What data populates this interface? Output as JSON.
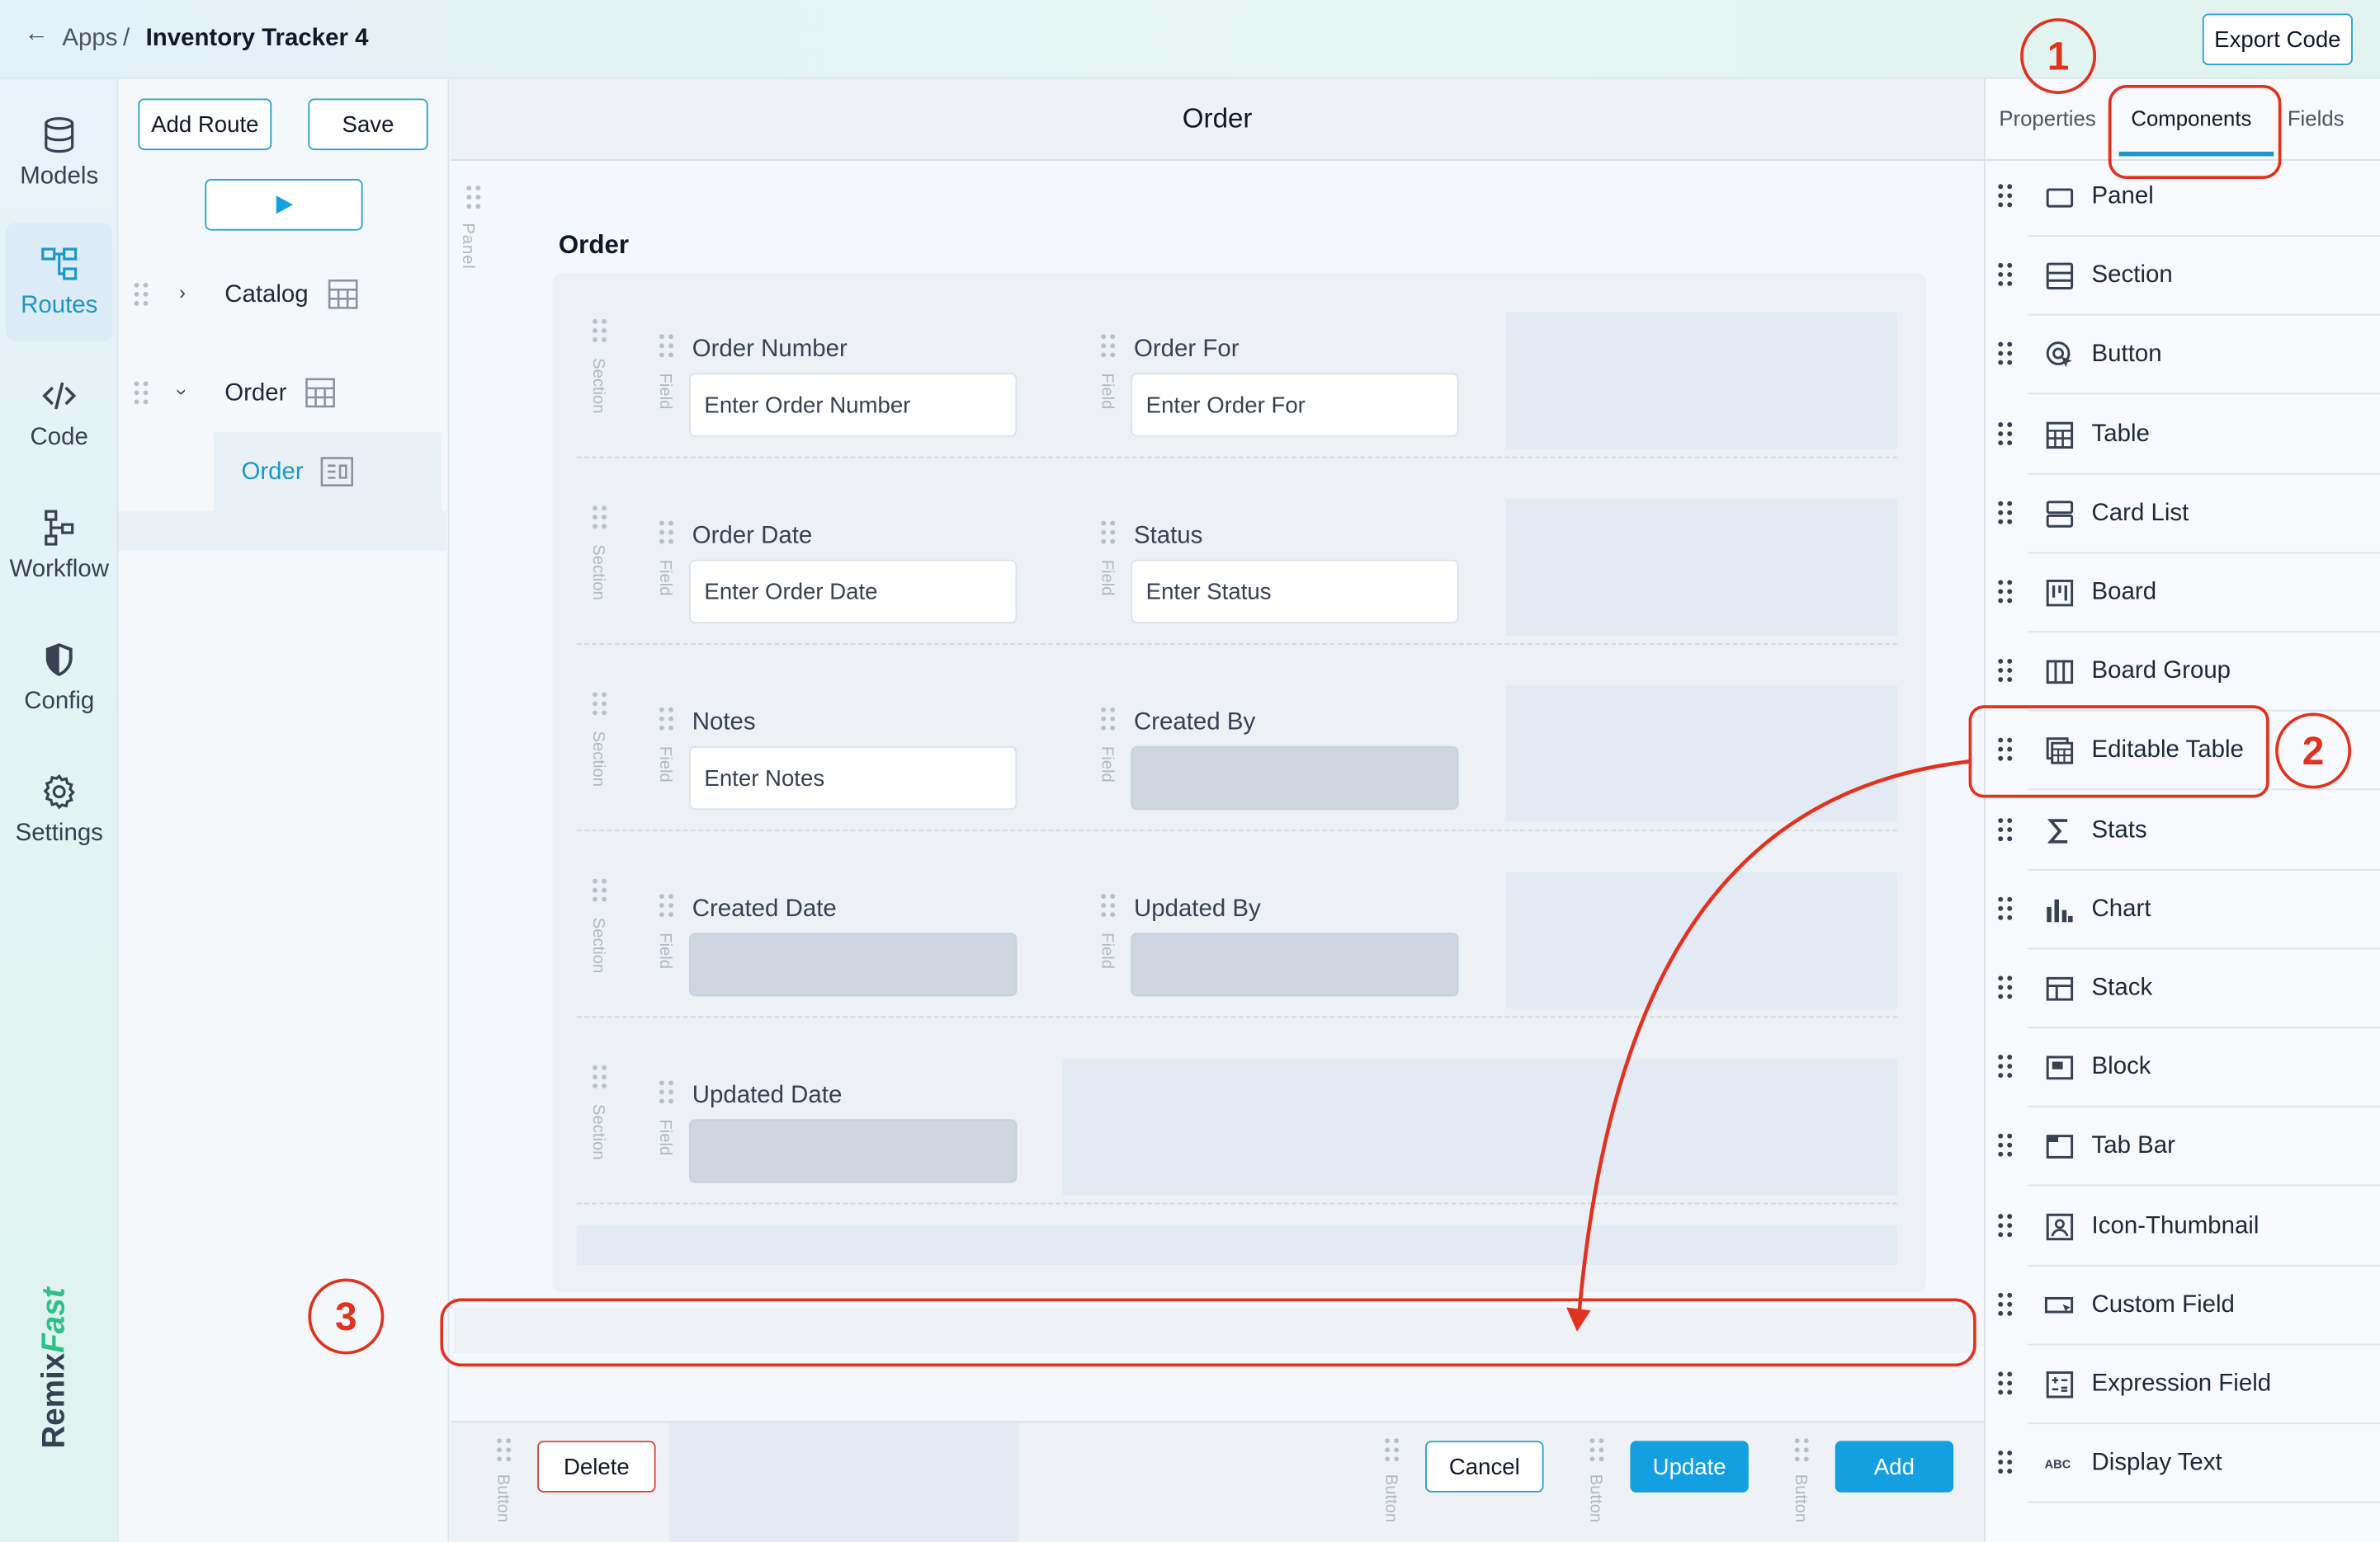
{
  "header": {
    "back_icon": "arrow-left-icon",
    "breadcrumb_parent": "Apps",
    "breadcrumb_sep": "/",
    "app_title": "Inventory Tracker 4",
    "export_label": "Export Code"
  },
  "rail": {
    "items": [
      {
        "label": "Models",
        "icon": "database-icon"
      },
      {
        "label": "Routes",
        "icon": "routes-icon",
        "active": true
      },
      {
        "label": "Code",
        "icon": "code-icon"
      },
      {
        "label": "Workflow",
        "icon": "workflow-icon"
      },
      {
        "label": "Config",
        "icon": "shield-icon"
      },
      {
        "label": "Settings",
        "icon": "gear-icon"
      }
    ],
    "brand_a": "Remix",
    "brand_b": "Fast"
  },
  "routes": {
    "add_route_label": "Add Route",
    "save_label": "Save",
    "tree": [
      {
        "label": "Catalog",
        "expanded": false
      },
      {
        "label": "Order",
        "expanded": true
      },
      {
        "label": "Order",
        "child": true
      }
    ]
  },
  "canvas": {
    "header_title": "Order",
    "panel_tag": "Panel",
    "form_title": "Order",
    "section_tag": "Section",
    "field_tag": "Field",
    "button_tag": "Button",
    "fields": [
      {
        "label": "Order Number",
        "placeholder": "Enter Order Number"
      },
      {
        "label": "Order For",
        "placeholder": "Enter Order For"
      },
      {
        "label": "Order Date",
        "placeholder": "Enter Order Date"
      },
      {
        "label": "Status",
        "placeholder": "Enter Status"
      },
      {
        "label": "Notes",
        "placeholder": "Enter Notes"
      },
      {
        "label": "Created By",
        "placeholder": ""
      },
      {
        "label": "Created Date",
        "placeholder": ""
      },
      {
        "label": "Updated By",
        "placeholder": ""
      },
      {
        "label": "Updated Date",
        "placeholder": ""
      }
    ],
    "footer": {
      "delete_label": "Delete",
      "cancel_label": "Cancel",
      "update_label": "Update",
      "add_label": "Add"
    }
  },
  "right_panel": {
    "tabs": [
      "Properties",
      "Components",
      "Fields"
    ],
    "active_tab": "Components",
    "components": [
      {
        "label": "Panel",
        "icon": "panel-icon"
      },
      {
        "label": "Section",
        "icon": "section-icon"
      },
      {
        "label": "Button",
        "icon": "button-icon"
      },
      {
        "label": "Table",
        "icon": "table-icon"
      },
      {
        "label": "Card List",
        "icon": "card-list-icon"
      },
      {
        "label": "Board",
        "icon": "board-icon"
      },
      {
        "label": "Board Group",
        "icon": "board-group-icon"
      },
      {
        "label": "Editable Table",
        "icon": "editable-table-icon"
      },
      {
        "label": "Stats",
        "icon": "sigma-icon"
      },
      {
        "label": "Chart",
        "icon": "bar-chart-icon"
      },
      {
        "label": "Stack",
        "icon": "stack-icon"
      },
      {
        "label": "Block",
        "icon": "block-icon"
      },
      {
        "label": "Tab Bar",
        "icon": "tab-bar-icon"
      },
      {
        "label": "Icon-Thumbnail",
        "icon": "icon-thumbnail-icon"
      },
      {
        "label": "Custom Field",
        "icon": "custom-field-icon"
      },
      {
        "label": "Expression Field",
        "icon": "expression-field-icon"
      },
      {
        "label": "Display Text",
        "icon": "display-text-icon"
      }
    ]
  },
  "annotations": {
    "step1": "1",
    "step2": "2",
    "step3": "3",
    "color": "#e0321f"
  },
  "colors": {
    "accent": "#1c98c4",
    "primary_button": "#149fe0",
    "danger_border": "#d6453b"
  }
}
